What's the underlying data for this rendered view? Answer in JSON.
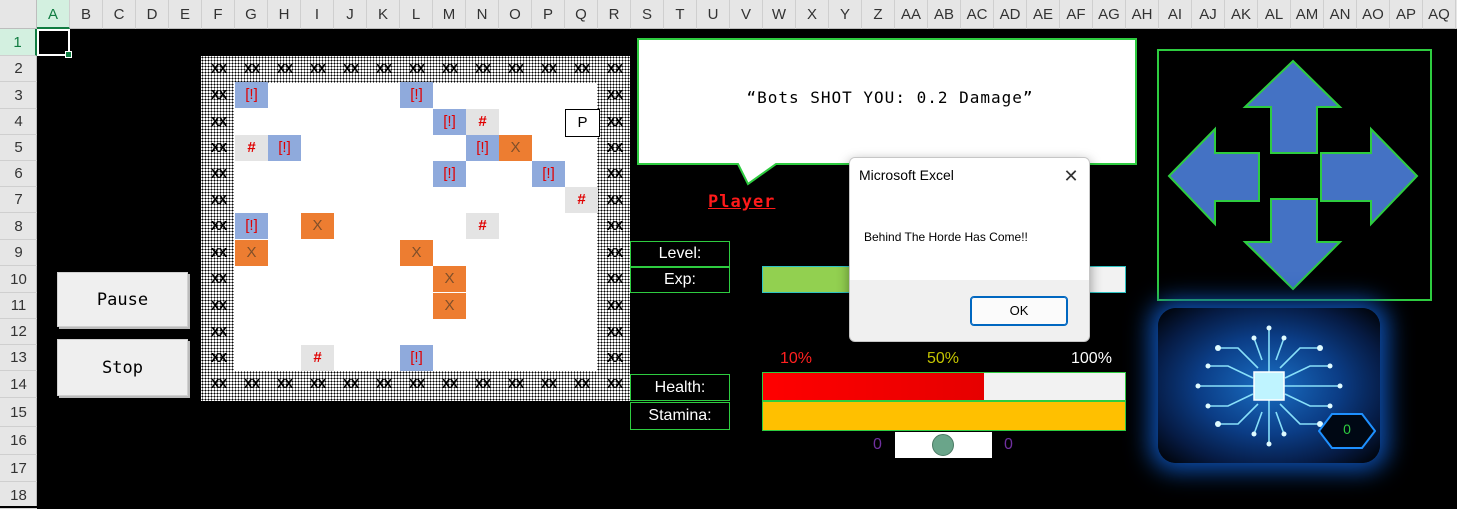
{
  "spreadsheet": {
    "columns": [
      "A",
      "B",
      "C",
      "D",
      "E",
      "F",
      "G",
      "H",
      "I",
      "J",
      "K",
      "L",
      "M",
      "N",
      "O",
      "P",
      "Q",
      "R",
      "S",
      "T",
      "U",
      "V",
      "W",
      "X",
      "Y",
      "Z",
      "AA",
      "AB",
      "AC",
      "AD",
      "AE",
      "AF",
      "AG",
      "AH",
      "AI",
      "AJ",
      "AK",
      "AL",
      "AM",
      "AN",
      "AO",
      "AP",
      "AQ"
    ],
    "rows": [
      "1",
      "2",
      "3",
      "4",
      "5",
      "6",
      "7",
      "8",
      "9",
      "10",
      "11",
      "12",
      "13",
      "14",
      "15",
      "16",
      "17",
      "18"
    ],
    "selected_cell": "A1"
  },
  "controls": {
    "pause_label": "Pause",
    "stop_label": "Stop"
  },
  "game": {
    "wall_marker": "XX",
    "tiles": [
      {
        "type": "blue",
        "text": "[!]",
        "row": 3,
        "col": "G"
      },
      {
        "type": "blue",
        "text": "[!]",
        "row": 3,
        "col": "L"
      },
      {
        "type": "blue",
        "text": "[!]",
        "row": 4,
        "col": "M"
      },
      {
        "type": "gray",
        "text": "#",
        "row": 4,
        "col": "N"
      },
      {
        "type": "player",
        "text": "P",
        "row": 4,
        "col": "Q"
      },
      {
        "type": "gray",
        "text": "#",
        "row": 5,
        "col": "G"
      },
      {
        "type": "blue",
        "text": "[!]",
        "row": 5,
        "col": "H"
      },
      {
        "type": "blue",
        "text": "[!]",
        "row": 5,
        "col": "N"
      },
      {
        "type": "orange",
        "text": "X",
        "row": 5,
        "col": "O"
      },
      {
        "type": "blue",
        "text": "[!]",
        "row": 6,
        "col": "M"
      },
      {
        "type": "blue",
        "text": "[!]",
        "row": 6,
        "col": "P"
      },
      {
        "type": "gray",
        "text": "#",
        "row": 7,
        "col": "Q"
      },
      {
        "type": "blue",
        "text": "[!]",
        "row": 8,
        "col": "G"
      },
      {
        "type": "orange",
        "text": "X",
        "row": 8,
        "col": "I"
      },
      {
        "type": "gray",
        "text": "#",
        "row": 8,
        "col": "N"
      },
      {
        "type": "orange",
        "text": "X",
        "row": 9,
        "col": "G"
      },
      {
        "type": "orange",
        "text": "X",
        "row": 9,
        "col": "L"
      },
      {
        "type": "orange",
        "text": "X",
        "row": 10,
        "col": "M"
      },
      {
        "type": "orange",
        "text": "X",
        "row": 11,
        "col": "M"
      },
      {
        "type": "gray",
        "text": "#",
        "row": 13,
        "col": "I"
      },
      {
        "type": "blue",
        "text": "[!]",
        "row": 13,
        "col": "L"
      }
    ]
  },
  "message": {
    "speech_text": "“Bots SHOT YOU: 0.2 Damage”",
    "speaker": "Player"
  },
  "stats": {
    "level_label": "Level:",
    "exp_label": "Exp:",
    "health_label": "Health:",
    "stamina_label": "Stamina:",
    "pct_10": "10%",
    "pct_50": "50%",
    "pct_100": "100%",
    "health_fraction": 0.61,
    "stamina_fraction": 1.0,
    "exp_fraction": 0.25,
    "slider_left_value": "0",
    "slider_right_value": "0",
    "colors": {
      "health": "#ff0000",
      "stamina": "#ffc000",
      "exp": "#92d050",
      "border": "#2ecc40"
    }
  },
  "dialog": {
    "title": "Microsoft Excel",
    "message": "Behind The Horde Has Come!!",
    "ok_label": "OK",
    "close_icon": "close-icon"
  },
  "dpad": {
    "icons": [
      "arrow-up-icon",
      "arrow-down-icon",
      "arrow-left-icon",
      "arrow-right-icon"
    ],
    "color": "#4472c4"
  },
  "chip": {
    "icon": "circuit-chip-icon",
    "score": "0"
  }
}
